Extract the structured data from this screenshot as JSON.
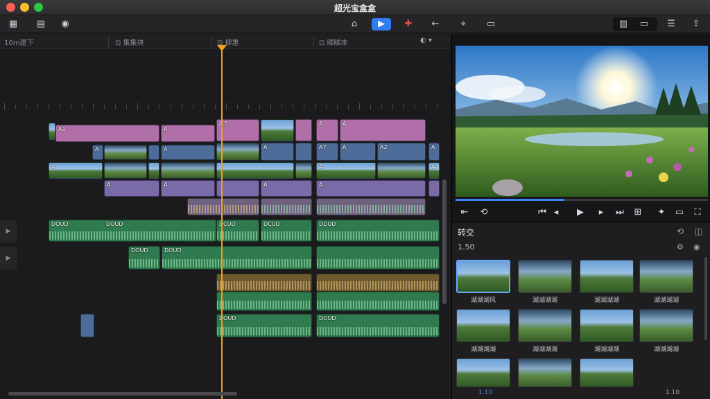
{
  "window": {
    "title": "超光宝盒盒"
  },
  "toolbar": {
    "left_icons": [
      "library-icon",
      "browser-icon",
      "location-icon"
    ],
    "center_icons": [
      "import-icon",
      "play-icon",
      "tool-icon",
      "back-icon",
      "split-icon",
      "comment-icon"
    ],
    "right_icons": [
      "view-a-icon",
      "view-b-icon",
      "list-icon",
      "export-icon"
    ]
  },
  "timeline": {
    "header_labels": [
      "10m建下",
      "集集块",
      "肆惠",
      "睇睇本"
    ],
    "rows": {
      "pink_labels": [
        "A1",
        "A",
        "A.5",
        "A",
        "A"
      ],
      "blue_labels": [
        "A",
        "A",
        "A",
        "A7",
        "A",
        "A2",
        "A"
      ],
      "thumb_labels": [
        "A",
        "A",
        "A"
      ],
      "violet_labels": [
        "A",
        "A",
        "A",
        "A"
      ],
      "audio_labels": [
        "DOUD",
        "DOUD",
        "DCUD",
        "DCUD",
        "DDUD"
      ],
      "audio2_labels": [
        "DOUD",
        "DOUD"
      ],
      "gold_labels": [
        "DOUD",
        "DOUD"
      ]
    }
  },
  "viewer": {
    "progress_fraction": 0.43,
    "controls": [
      "prev-frame-icon",
      "loop-icon",
      "rewind-icon",
      "step-back-icon",
      "play-icon",
      "step-forward-icon",
      "forward-icon",
      "crop-icon",
      "effects-icon",
      "screen-icon",
      "fullscreen-icon"
    ]
  },
  "effects": {
    "title": "转交",
    "subtitle": "1.50",
    "items": [
      {
        "label": "湖湖湖风",
        "selected": true
      },
      {
        "label": "湖湖湖湖",
        "selected": false
      },
      {
        "label": "湖湖湖湖",
        "selected": false
      },
      {
        "label": "湖湖湖湖",
        "selected": false
      },
      {
        "label": "湖湖湖湖",
        "selected": false
      },
      {
        "label": "湖湖湖湖",
        "selected": false
      },
      {
        "label": "湖湖湖湖",
        "selected": false
      },
      {
        "label": "湖湖湖湖",
        "selected": false
      },
      {
        "label": "",
        "selected": false
      },
      {
        "label": "",
        "selected": false
      },
      {
        "label": "",
        "selected": false
      }
    ],
    "footer_left": "1.10",
    "footer_right": "1.10"
  }
}
